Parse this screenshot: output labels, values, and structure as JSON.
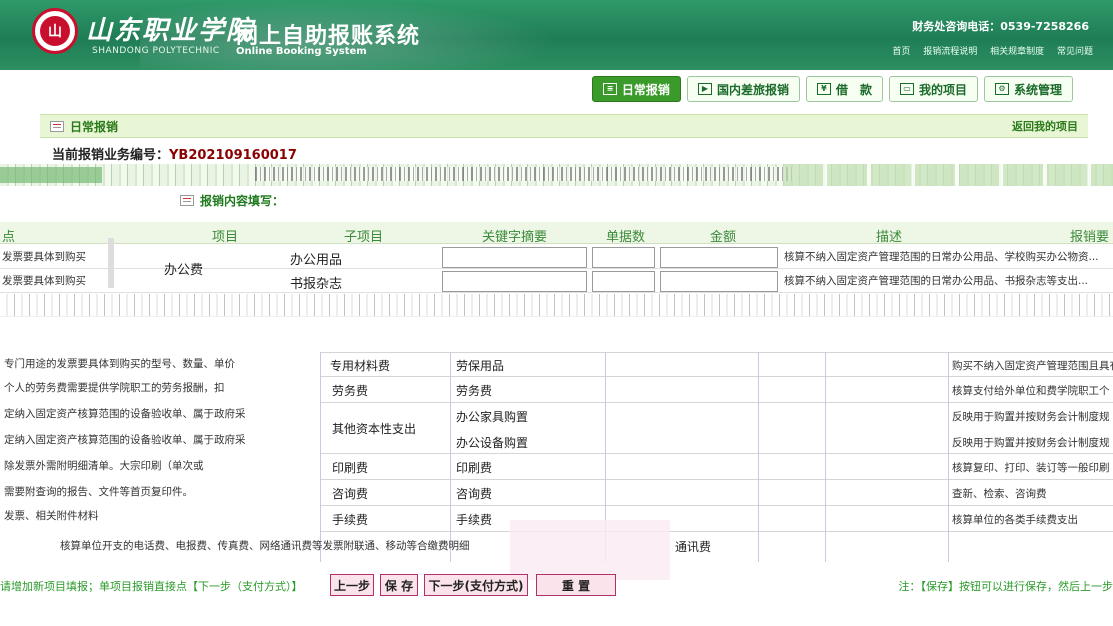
{
  "header": {
    "logo_text": "山",
    "school_name": "山东职业学院",
    "school_en": "SHANDONG POLYTECHNIC",
    "system_title": "网上自助报账系统",
    "system_en": "Online Booking System",
    "hotline": "财务处咨询电话：0539-7258266",
    "top_links": [
      "首页",
      "报销流程说明",
      "相关规章制度",
      "常见问题"
    ]
  },
  "modules": [
    {
      "label": "日常报销",
      "icon": "document-icon",
      "active": true
    },
    {
      "label": "国内差旅报销",
      "icon": "car-icon",
      "active": false
    },
    {
      "label": "借　款",
      "icon": "money-icon",
      "active": false
    },
    {
      "label": "我的项目",
      "icon": "folder-icon",
      "active": false
    },
    {
      "label": "系统管理",
      "icon": "gear-icon",
      "active": false
    }
  ],
  "breadcrumb": {
    "title": "日常报销",
    "return_link": "返回我的项目"
  },
  "business": {
    "label": "当前报销业务编号：",
    "number": "YB202109160017"
  },
  "section_title": "报销内容填写：",
  "grid": {
    "headers": [
      "点",
      "项目",
      "子项目",
      "关键字摘要",
      "单据数",
      "金额",
      "描述",
      "报销要"
    ],
    "rows": [
      {
        "note": "发票要具体到购买",
        "item": "办公费",
        "sub": "办公用品",
        "desc": "核算不纳入固定资产管理范围的日常办公用品、学校购买办公物资..."
      },
      {
        "note": "发票要具体到购买",
        "item": "",
        "sub": "书报杂志",
        "desc": "核算不纳入固定资产管理范围的日常办公用品、书报杂志等支出..."
      }
    ]
  },
  "overlay": {
    "rows": [
      {
        "item": "专用材料费",
        "sub": "劳保用品",
        "desc": "购买不纳入固定资产管理范围且具有",
        "left_note": "专门用途的发票要具体到购买的型号、数量、单价"
      },
      {
        "item": "劳务费",
        "sub": "劳务费",
        "desc": "核算支付给外单位和费学院职工个",
        "left_note": "个人的劳务费需要提供学院职工的劳务报酬，扣"
      },
      {
        "item": "其他资本性支出",
        "sub": "办公家具购置",
        "desc": "反映用于购置并按财务会计制度规",
        "left_note": "定纳入固定资产核算范围的设备验收单、属于政府采"
      },
      {
        "item": "",
        "sub": "办公设备购置",
        "desc": "反映用于购置并按财务会计制度规",
        "left_note": "定纳入固定资产核算范围的设备验收单、属于政府采"
      },
      {
        "item": "印刷费",
        "sub": "印刷费",
        "desc": "核算复印、打印、装订等一般印刷",
        "left_note": "除发票外需附明细清单。大宗印刷（单次或"
      },
      {
        "item": "咨询费",
        "sub": "咨询费",
        "desc": "查新、检索、咨询费",
        "left_note": "需要附查询的报告、文件等首页复印件。"
      },
      {
        "item": "手续费",
        "sub": "手续费",
        "desc": "核算单位的各类手续费支出",
        "left_note": "发票、相关附件材料"
      },
      {
        "item": "",
        "sub": "通讯费",
        "desc": "",
        "left_note": "核算单位开支的电话费、电报费、传真费、网络通讯费等发票附联通、移动等合缴费明细"
      }
    ]
  },
  "footer": {
    "hint_left": "请增加新项目填报；单项目报销直接点【下一步（支付方式）】",
    "buttons": [
      "上一步",
      "保 存",
      "下一步(支付方式)",
      "重 置"
    ],
    "hint_right": "注：【保存】按钮可以进行保存，然后上一步"
  }
}
